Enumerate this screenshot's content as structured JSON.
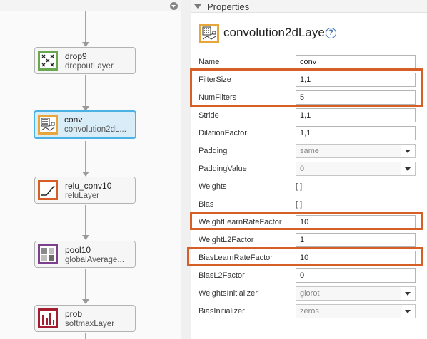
{
  "canvas": {
    "nodes": [
      {
        "name": "drop9",
        "type": "dropoutLayer",
        "icon": "dropout-icon",
        "color": "#6aa84f"
      },
      {
        "name": "conv",
        "type": "convolution2dL...",
        "icon": "convolution-icon",
        "color": "#e6a63c",
        "selected": true
      },
      {
        "name": "relu_conv10",
        "type": "reluLayer",
        "icon": "relu-icon",
        "color": "#d65f27"
      },
      {
        "name": "pool10",
        "type": "globalAverage...",
        "icon": "pooling-icon",
        "color": "#7b3f8c"
      },
      {
        "name": "prob",
        "type": "softmaxLayer",
        "icon": "softmax-icon",
        "color": "#a51c30"
      }
    ]
  },
  "properties": {
    "header": "Properties",
    "layer_type": "convolution2dLayer",
    "help": "?",
    "fields": [
      {
        "label": "Name",
        "kind": "input",
        "value": "conv"
      },
      {
        "label": "FilterSize",
        "kind": "input",
        "value": "1,1",
        "highlighted": true
      },
      {
        "label": "NumFilters",
        "kind": "input",
        "value": "5",
        "highlighted": true
      },
      {
        "label": "Stride",
        "kind": "input",
        "value": "1,1"
      },
      {
        "label": "DilationFactor",
        "kind": "input",
        "value": "1,1"
      },
      {
        "label": "Padding",
        "kind": "select",
        "value": "same"
      },
      {
        "label": "PaddingValue",
        "kind": "select",
        "value": "0"
      },
      {
        "label": "Weights",
        "kind": "static",
        "value": "[ ]"
      },
      {
        "label": "Bias",
        "kind": "static",
        "value": "[ ]"
      },
      {
        "label": "WeightLearnRateFactor",
        "kind": "input",
        "value": "10",
        "highlighted": true
      },
      {
        "label": "WeightL2Factor",
        "kind": "input",
        "value": "1"
      },
      {
        "label": "BiasLearnRateFactor",
        "kind": "input",
        "value": "10",
        "highlighted": true
      },
      {
        "label": "BiasL2Factor",
        "kind": "input",
        "value": "0"
      },
      {
        "label": "WeightsInitializer",
        "kind": "select",
        "value": "glorot"
      },
      {
        "label": "BiasInitializer",
        "kind": "select",
        "value": "zeros"
      }
    ]
  },
  "colors": {
    "highlight": "#d65f27",
    "selection": "#4cb2e3",
    "help": "#3b6fb6"
  }
}
